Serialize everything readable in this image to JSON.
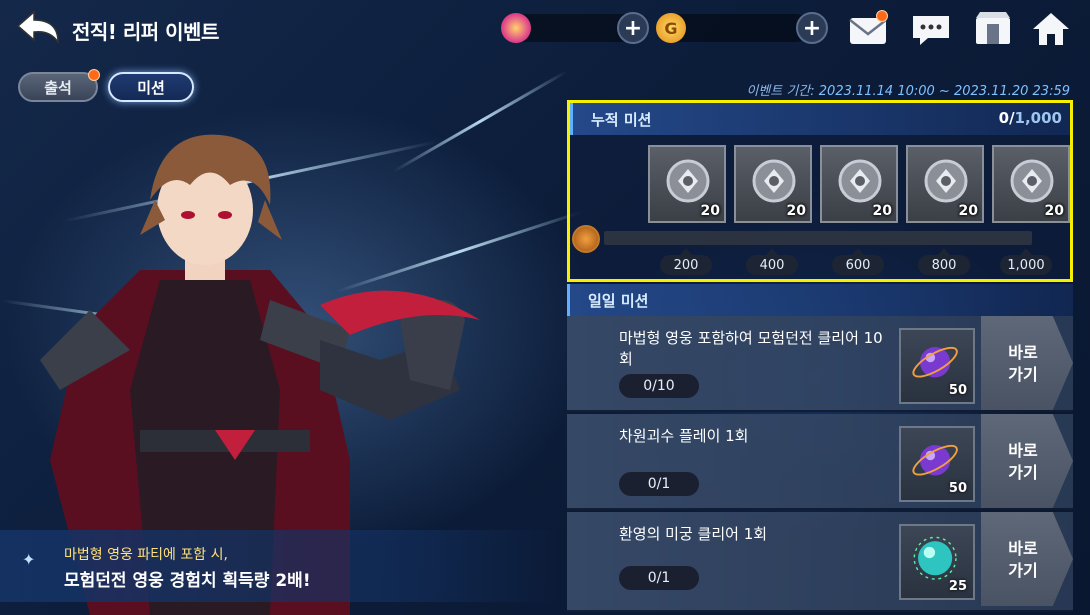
{
  "header": {
    "title": "전직! 리퍼 이벤트",
    "currency_gem": "",
    "currency_gold": "",
    "gold_symbol": "G"
  },
  "tabs": [
    {
      "label": "출석",
      "active": false,
      "notification": true
    },
    {
      "label": "미션",
      "active": true,
      "notification": false
    }
  ],
  "event_period": {
    "prefix": "이벤트 기간:",
    "range": " 2023.11.14 10:00 ~ 2023.11.20 23:59"
  },
  "cumulative": {
    "title": "누적 미션",
    "current": "0",
    "separator": "/",
    "max": "1,000",
    "rewards": [
      {
        "quantity": "20"
      },
      {
        "quantity": "20"
      },
      {
        "quantity": "20"
      },
      {
        "quantity": "20"
      },
      {
        "quantity": "20"
      }
    ],
    "milestones": [
      "200",
      "400",
      "600",
      "800",
      "1,000"
    ],
    "progress_fraction": 0
  },
  "daily": {
    "title": "일일 미션",
    "go_label": "바로 가기",
    "missions": [
      {
        "text": "마법형 영웅 포함하여 모험던전 클리어 10회",
        "progress": "0/10",
        "reward_qty": "50",
        "reward_type": "purple-orb"
      },
      {
        "text": "차원괴수 플레이 1회",
        "progress": "0/1",
        "reward_qty": "50",
        "reward_type": "purple-orb"
      },
      {
        "text": "환영의 미궁 클리어 1회",
        "progress": "0/1",
        "reward_qty": "25",
        "reward_type": "cyan-orb"
      }
    ]
  },
  "info": {
    "line1": "마법형 영웅 파티에 포함 시,",
    "line2": "모험던전 영웅 경험치 획득량 2배!"
  },
  "colors": {
    "highlight_border": "#f6f000",
    "notification": "#ff6a1a",
    "accent_blue": "#5fb0ff"
  }
}
